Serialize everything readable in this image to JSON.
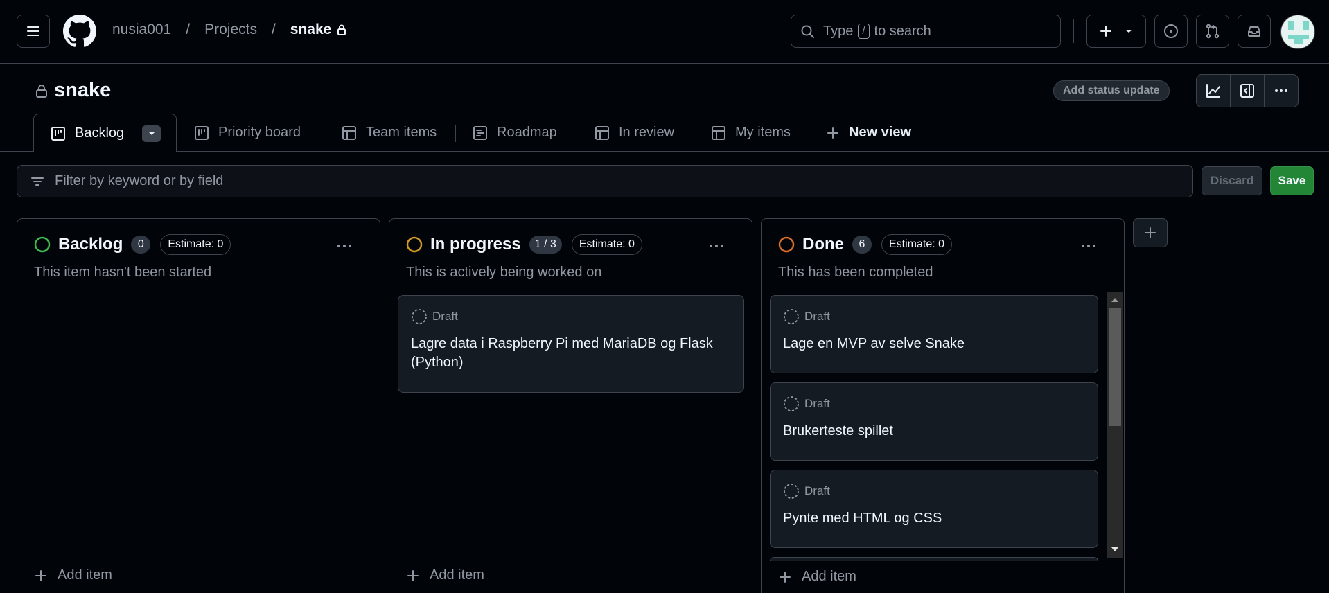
{
  "header": {
    "breadcrumbs": [
      "nusia001",
      "Projects",
      "snake"
    ],
    "search_before": "Type",
    "search_key": "/",
    "search_after": "to search"
  },
  "project": {
    "title": "snake",
    "status_update_label": "Add status update"
  },
  "tabs": [
    {
      "label": "Backlog",
      "icon": "board-icon",
      "active": true
    },
    {
      "label": "Priority board",
      "icon": "board-icon"
    },
    {
      "label": "Team items",
      "icon": "table-icon"
    },
    {
      "label": "Roadmap",
      "icon": "roadmap-icon"
    },
    {
      "label": "In review",
      "icon": "table-icon"
    },
    {
      "label": "My items",
      "icon": "table-icon"
    },
    {
      "label": "New view",
      "icon": "plus-icon"
    }
  ],
  "filter": {
    "placeholder": "Filter by keyword or by field",
    "discard_label": "Discard",
    "save_label": "Save"
  },
  "columns": [
    {
      "title": "Backlog",
      "count": "0",
      "estimate": "Estimate: 0",
      "description": "This item hasn't been started",
      "color": "#3fb950",
      "add_label": "Add item",
      "cards": []
    },
    {
      "title": "In progress",
      "count": "1 / 3",
      "estimate": "Estimate: 0",
      "description": "This is actively being worked on",
      "color": "#d29922",
      "add_label": "Add item",
      "cards": [
        {
          "type": "Draft",
          "title": "Lagre data i Raspberry Pi med MariaDB og Flask (Python)"
        }
      ]
    },
    {
      "title": "Done",
      "count": "6",
      "estimate": "Estimate: 0",
      "description": "This has been completed",
      "color": "#db6d28",
      "add_label": "Add item",
      "cards": [
        {
          "type": "Draft",
          "title": "Lage en MVP av selve Snake"
        },
        {
          "type": "Draft",
          "title": "Brukerteste spillet"
        },
        {
          "type": "Draft",
          "title": "Pynte med HTML og CSS"
        }
      ]
    }
  ],
  "colors": {
    "background": "#010409",
    "border": "#3d444d",
    "accent_save": "#238636"
  }
}
